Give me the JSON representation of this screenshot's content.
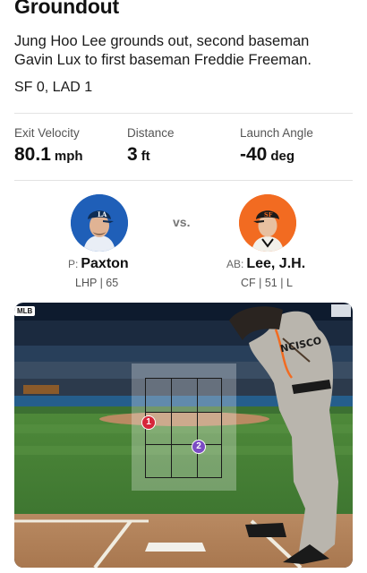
{
  "play": {
    "title": "Groundout",
    "description": "Jung Hoo Lee grounds out, second baseman Gavin Lux to first baseman Freddie Freeman.",
    "score": "SF 0, LAD 1"
  },
  "stats": [
    {
      "label": "Exit Velocity",
      "value": "80.1",
      "unit": "mph"
    },
    {
      "label": "Distance",
      "value": "3",
      "unit": "ft"
    },
    {
      "label": "Launch Angle",
      "value": "-40",
      "unit": "deg"
    }
  ],
  "matchup": {
    "vs_label": "vs.",
    "pitcher": {
      "role": "P:",
      "name": "Paxton",
      "info": "LHP | 65"
    },
    "batter": {
      "role": "AB:",
      "name": "Lee, J.H.",
      "info": "CF | 51 | L"
    }
  },
  "field_view": {
    "badge": "MLB",
    "pitches": [
      {
        "number": "1",
        "color": "#d6263a"
      },
      {
        "number": "2",
        "color": "#7b4bc4"
      }
    ]
  },
  "colors": {
    "dodgers_blue": "#1f5fb8",
    "giants_orange": "#f26b21"
  }
}
